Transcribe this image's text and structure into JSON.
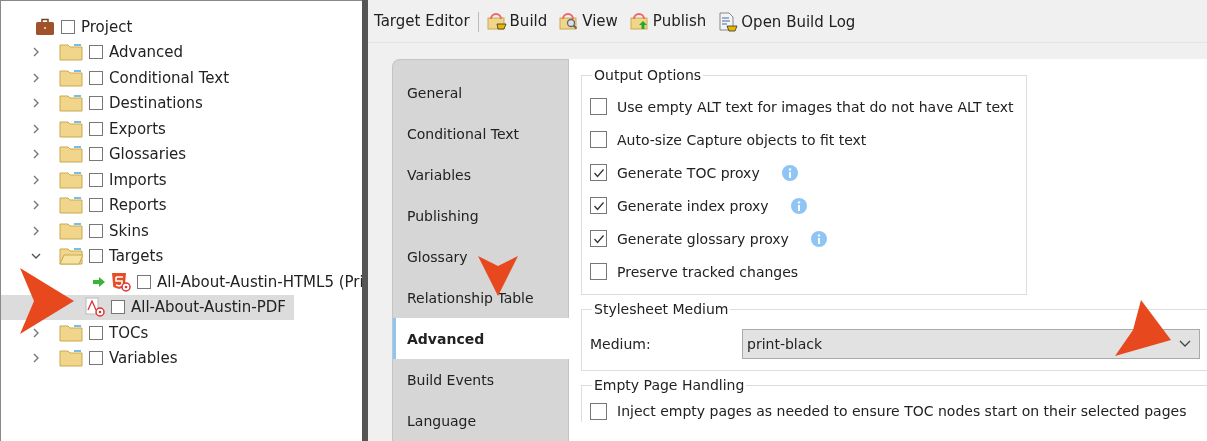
{
  "project_tree": {
    "label": "Project",
    "kind": "project",
    "checked": false,
    "children": [
      {
        "label": "Advanced",
        "kind": "folder",
        "checked": false,
        "expanded": false
      },
      {
        "label": "Conditional Text",
        "kind": "folder",
        "checked": false,
        "expanded": false
      },
      {
        "label": "Destinations",
        "kind": "folder",
        "checked": false,
        "expanded": false
      },
      {
        "label": "Exports",
        "kind": "folder",
        "checked": false,
        "expanded": false
      },
      {
        "label": "Glossaries",
        "kind": "folder",
        "checked": false,
        "expanded": false
      },
      {
        "label": "Imports",
        "kind": "folder",
        "checked": false,
        "expanded": false
      },
      {
        "label": "Reports",
        "kind": "folder",
        "checked": false,
        "expanded": false
      },
      {
        "label": "Skins",
        "kind": "folder",
        "checked": false,
        "expanded": false
      },
      {
        "label": "Targets",
        "kind": "folder",
        "checked": false,
        "expanded": true,
        "children": [
          {
            "label": "All-About-Austin-HTML5 (Pri",
            "kind": "html5",
            "checked": false,
            "primary": true,
            "selected": false
          },
          {
            "label": "All-About-Austin-PDF",
            "kind": "pdf",
            "checked": false,
            "primary": false,
            "selected": true
          }
        ]
      },
      {
        "label": "TOCs",
        "kind": "folder",
        "checked": false,
        "expanded": false
      },
      {
        "label": "Variables",
        "kind": "folder",
        "checked": false,
        "expanded": false
      }
    ]
  },
  "toolbar": {
    "title": "Target Editor",
    "buttons": [
      {
        "label": "Build",
        "kind": "build"
      },
      {
        "label": "View",
        "kind": "view"
      },
      {
        "label": "Publish",
        "kind": "publish"
      },
      {
        "label": "Open Build Log",
        "kind": "log"
      }
    ]
  },
  "tabs": [
    {
      "label": "General",
      "selected": false
    },
    {
      "label": "Conditional Text",
      "selected": false
    },
    {
      "label": "Variables",
      "selected": false
    },
    {
      "label": "Publishing",
      "selected": false
    },
    {
      "label": "Glossary",
      "selected": false
    },
    {
      "label": "Relationship Table",
      "selected": false
    },
    {
      "label": "Advanced",
      "selected": true
    },
    {
      "label": "Build Events",
      "selected": false
    },
    {
      "label": "Language",
      "selected": false
    }
  ],
  "output_options": {
    "title": "Output Options",
    "options": [
      {
        "label": "Use empty ALT text for images that do not have ALT text",
        "checked": false,
        "info": false
      },
      {
        "label": "Auto-size Capture objects to fit text",
        "checked": false,
        "info": false
      },
      {
        "label": "Generate TOC proxy",
        "checked": true,
        "info": true
      },
      {
        "label": "Generate index proxy",
        "checked": true,
        "info": true
      },
      {
        "label": "Generate glossary proxy",
        "checked": true,
        "info": true
      },
      {
        "label": "Preserve tracked changes",
        "checked": false,
        "info": false
      }
    ]
  },
  "stylesheet_medium": {
    "title": "Stylesheet Medium",
    "label": "Medium:",
    "value": "print-black"
  },
  "empty_page_handling": {
    "title": "Empty Page Handling",
    "options": [
      {
        "label": "Inject empty pages as needed to ensure TOC nodes start on their selected pages",
        "checked": false
      }
    ]
  }
}
